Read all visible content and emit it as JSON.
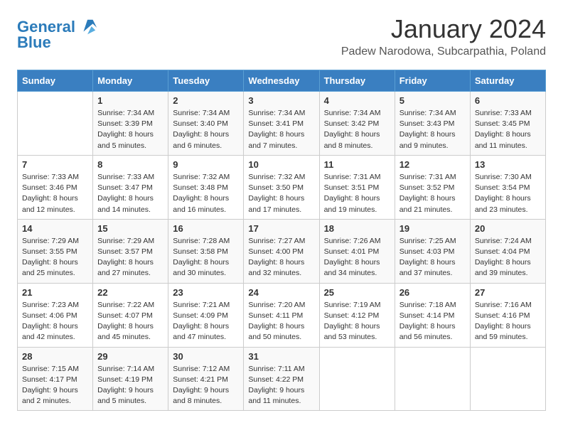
{
  "header": {
    "logo_line1": "General",
    "logo_line2": "Blue",
    "month_title": "January 2024",
    "subtitle": "Padew Narodowa, Subcarpathia, Poland"
  },
  "weekdays": [
    "Sunday",
    "Monday",
    "Tuesday",
    "Wednesday",
    "Thursday",
    "Friday",
    "Saturday"
  ],
  "weeks": [
    [
      {
        "day": "",
        "info": ""
      },
      {
        "day": "1",
        "info": "Sunrise: 7:34 AM\nSunset: 3:39 PM\nDaylight: 8 hours\nand 5 minutes."
      },
      {
        "day": "2",
        "info": "Sunrise: 7:34 AM\nSunset: 3:40 PM\nDaylight: 8 hours\nand 6 minutes."
      },
      {
        "day": "3",
        "info": "Sunrise: 7:34 AM\nSunset: 3:41 PM\nDaylight: 8 hours\nand 7 minutes."
      },
      {
        "day": "4",
        "info": "Sunrise: 7:34 AM\nSunset: 3:42 PM\nDaylight: 8 hours\nand 8 minutes."
      },
      {
        "day": "5",
        "info": "Sunrise: 7:34 AM\nSunset: 3:43 PM\nDaylight: 8 hours\nand 9 minutes."
      },
      {
        "day": "6",
        "info": "Sunrise: 7:33 AM\nSunset: 3:45 PM\nDaylight: 8 hours\nand 11 minutes."
      }
    ],
    [
      {
        "day": "7",
        "info": "Sunrise: 7:33 AM\nSunset: 3:46 PM\nDaylight: 8 hours\nand 12 minutes."
      },
      {
        "day": "8",
        "info": "Sunrise: 7:33 AM\nSunset: 3:47 PM\nDaylight: 8 hours\nand 14 minutes."
      },
      {
        "day": "9",
        "info": "Sunrise: 7:32 AM\nSunset: 3:48 PM\nDaylight: 8 hours\nand 16 minutes."
      },
      {
        "day": "10",
        "info": "Sunrise: 7:32 AM\nSunset: 3:50 PM\nDaylight: 8 hours\nand 17 minutes."
      },
      {
        "day": "11",
        "info": "Sunrise: 7:31 AM\nSunset: 3:51 PM\nDaylight: 8 hours\nand 19 minutes."
      },
      {
        "day": "12",
        "info": "Sunrise: 7:31 AM\nSunset: 3:52 PM\nDaylight: 8 hours\nand 21 minutes."
      },
      {
        "day": "13",
        "info": "Sunrise: 7:30 AM\nSunset: 3:54 PM\nDaylight: 8 hours\nand 23 minutes."
      }
    ],
    [
      {
        "day": "14",
        "info": "Sunrise: 7:29 AM\nSunset: 3:55 PM\nDaylight: 8 hours\nand 25 minutes."
      },
      {
        "day": "15",
        "info": "Sunrise: 7:29 AM\nSunset: 3:57 PM\nDaylight: 8 hours\nand 27 minutes."
      },
      {
        "day": "16",
        "info": "Sunrise: 7:28 AM\nSunset: 3:58 PM\nDaylight: 8 hours\nand 30 minutes."
      },
      {
        "day": "17",
        "info": "Sunrise: 7:27 AM\nSunset: 4:00 PM\nDaylight: 8 hours\nand 32 minutes."
      },
      {
        "day": "18",
        "info": "Sunrise: 7:26 AM\nSunset: 4:01 PM\nDaylight: 8 hours\nand 34 minutes."
      },
      {
        "day": "19",
        "info": "Sunrise: 7:25 AM\nSunset: 4:03 PM\nDaylight: 8 hours\nand 37 minutes."
      },
      {
        "day": "20",
        "info": "Sunrise: 7:24 AM\nSunset: 4:04 PM\nDaylight: 8 hours\nand 39 minutes."
      }
    ],
    [
      {
        "day": "21",
        "info": "Sunrise: 7:23 AM\nSunset: 4:06 PM\nDaylight: 8 hours\nand 42 minutes."
      },
      {
        "day": "22",
        "info": "Sunrise: 7:22 AM\nSunset: 4:07 PM\nDaylight: 8 hours\nand 45 minutes."
      },
      {
        "day": "23",
        "info": "Sunrise: 7:21 AM\nSunset: 4:09 PM\nDaylight: 8 hours\nand 47 minutes."
      },
      {
        "day": "24",
        "info": "Sunrise: 7:20 AM\nSunset: 4:11 PM\nDaylight: 8 hours\nand 50 minutes."
      },
      {
        "day": "25",
        "info": "Sunrise: 7:19 AM\nSunset: 4:12 PM\nDaylight: 8 hours\nand 53 minutes."
      },
      {
        "day": "26",
        "info": "Sunrise: 7:18 AM\nSunset: 4:14 PM\nDaylight: 8 hours\nand 56 minutes."
      },
      {
        "day": "27",
        "info": "Sunrise: 7:16 AM\nSunset: 4:16 PM\nDaylight: 8 hours\nand 59 minutes."
      }
    ],
    [
      {
        "day": "28",
        "info": "Sunrise: 7:15 AM\nSunset: 4:17 PM\nDaylight: 9 hours\nand 2 minutes."
      },
      {
        "day": "29",
        "info": "Sunrise: 7:14 AM\nSunset: 4:19 PM\nDaylight: 9 hours\nand 5 minutes."
      },
      {
        "day": "30",
        "info": "Sunrise: 7:12 AM\nSunset: 4:21 PM\nDaylight: 9 hours\nand 8 minutes."
      },
      {
        "day": "31",
        "info": "Sunrise: 7:11 AM\nSunset: 4:22 PM\nDaylight: 9 hours\nand 11 minutes."
      },
      {
        "day": "",
        "info": ""
      },
      {
        "day": "",
        "info": ""
      },
      {
        "day": "",
        "info": ""
      }
    ]
  ]
}
